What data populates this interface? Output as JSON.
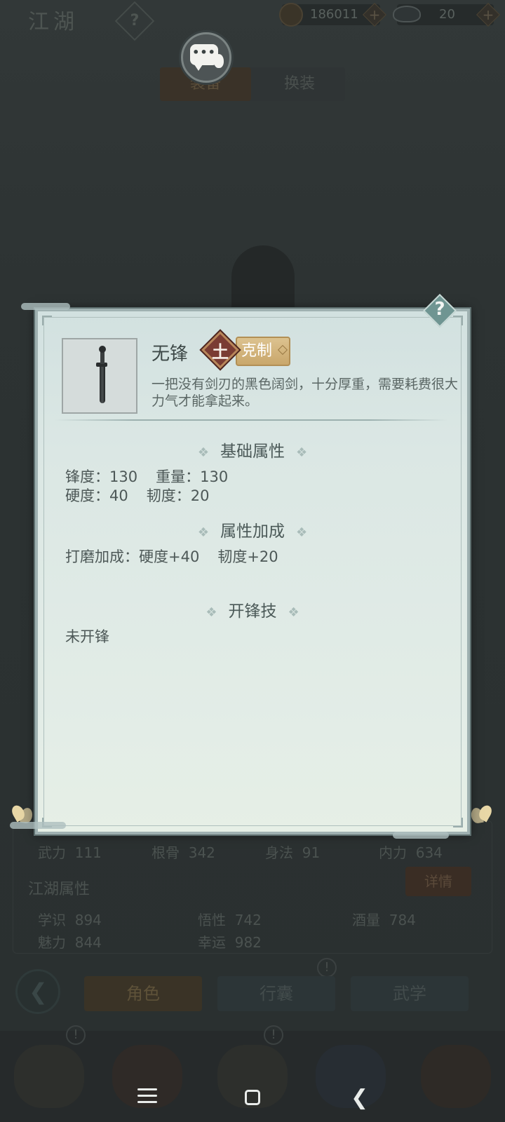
{
  "background": {
    "title": "江湖",
    "help_glyph": "?",
    "currency": {
      "coins": "186011",
      "ingots": "20"
    },
    "tabs": [
      "装备",
      "换装"
    ],
    "stats": [
      {
        "label": "武力",
        "value": "111"
      },
      {
        "label": "根骨",
        "value": "342"
      },
      {
        "label": "身法",
        "value": "91"
      },
      {
        "label": "内力",
        "value": "634"
      }
    ],
    "section_title": "江湖属性",
    "detail_button": "详情",
    "jianghu_stats": [
      {
        "label": "学识",
        "value": "894"
      },
      {
        "label": "悟性",
        "value": "742"
      },
      {
        "label": "酒量",
        "value": "784"
      },
      {
        "label": "魅力",
        "value": "844"
      },
      {
        "label": "幸运",
        "value": "982"
      }
    ],
    "nav_buttons": [
      "角色",
      "行囊",
      "武学"
    ],
    "alert_glyph": "!"
  },
  "popup": {
    "help_glyph": "?",
    "item": {
      "name": "无锋",
      "element_glyph": "土",
      "counter_label": "克制",
      "description": "一把没有剑刃的黑色阔剑，十分厚重，需要耗费很大力气才能拿起来。"
    },
    "sections": {
      "base": {
        "title": "基础属性",
        "line1": "锋度：130",
        "line1b": "重量：130",
        "line2": "硬度：40",
        "line2b": "韧度：20"
      },
      "bonus": {
        "title": "属性加成",
        "line": "打磨加成：硬度+40",
        "lineb": "韧度+20"
      },
      "skill": {
        "title": "开锋技",
        "value": "未开锋"
      }
    },
    "ornament": "❖"
  },
  "system_nav": {
    "icons": [
      "menu-icon",
      "home-icon",
      "back-icon"
    ]
  }
}
